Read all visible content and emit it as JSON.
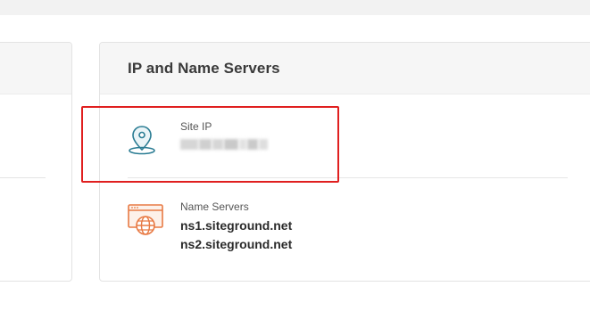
{
  "card": {
    "title": "IP and Name Servers"
  },
  "site_ip": {
    "label": "Site IP",
    "icon": "location-pin-icon",
    "value_hidden": true
  },
  "name_servers": {
    "label": "Name Servers",
    "icon": "web-globe-icon",
    "values": [
      "ns1.siteground.net",
      "ns2.siteground.net"
    ]
  },
  "colors": {
    "accent_teal": "#2a7c93",
    "accent_orange": "#e87a44",
    "highlight_red": "#e01f1f"
  }
}
